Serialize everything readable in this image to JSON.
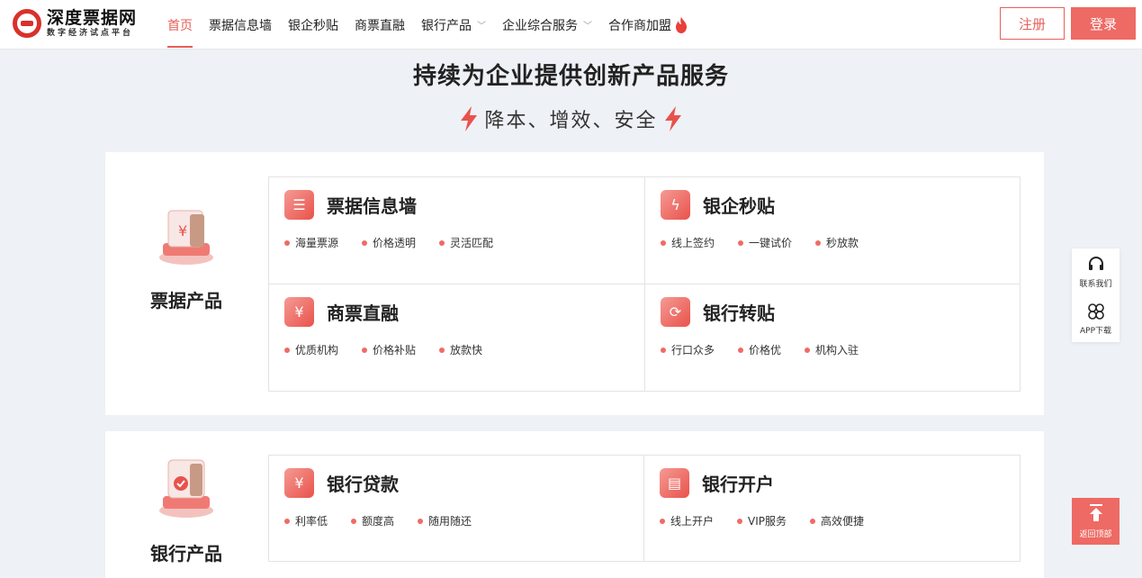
{
  "brand": {
    "name": "深度票据网",
    "slogan": "数字经济试点平台",
    "color": "#d9312b"
  },
  "nav": {
    "items": [
      {
        "label": "首页",
        "active": true
      },
      {
        "label": "票据信息墙"
      },
      {
        "label": "银企秒贴"
      },
      {
        "label": "商票直融"
      },
      {
        "label": "银行产品",
        "dropdown": true
      },
      {
        "label": "企业综合服务",
        "dropdown": true
      },
      {
        "label": "合作商加盟",
        "hot": true
      }
    ]
  },
  "auth": {
    "register": "注册",
    "login": "登录"
  },
  "hero": {
    "title": "持续为企业提供创新产品服务",
    "subtitle": "降本、增效、安全"
  },
  "sections": [
    {
      "category": "票据产品",
      "products": [
        {
          "title": "票据信息墙",
          "icon": "receipt-icon",
          "tags": [
            "海量票源",
            "价格透明",
            "灵活匹配"
          ]
        },
        {
          "title": "银企秒贴",
          "icon": "lightning-icon",
          "tags": [
            "线上签约",
            "一键试价",
            "秒放款"
          ]
        },
        {
          "title": "商票直融",
          "icon": "money-bag-icon",
          "tags": [
            "优质机构",
            "价格补贴",
            "放款快"
          ]
        },
        {
          "title": "银行转贴",
          "icon": "exchange-icon",
          "tags": [
            "行口众多",
            "价格优",
            "机构入驻"
          ]
        }
      ]
    },
    {
      "category": "银行产品",
      "products": [
        {
          "title": "银行贷款",
          "icon": "loan-icon",
          "tags": [
            "利率低",
            "额度高",
            "随用随还"
          ]
        },
        {
          "title": "银行开户",
          "icon": "account-icon",
          "tags": [
            "线上开户",
            "VIP服务",
            "高效便捷"
          ]
        }
      ]
    }
  ],
  "float": {
    "contact": "联系我们",
    "app": "APP下载",
    "back_top": "返回顶部"
  },
  "accent": "#ee6a64"
}
